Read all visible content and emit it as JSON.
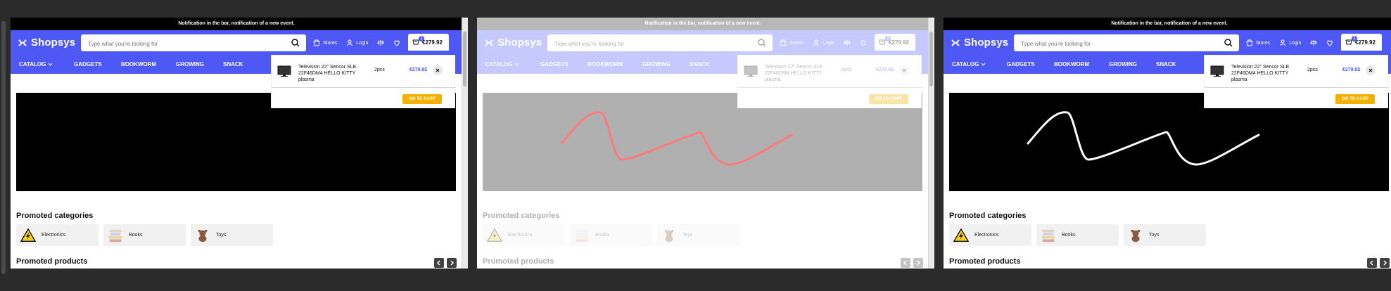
{
  "notification": "Notification in the bar, notification of a new event.",
  "brand": "Shopsys",
  "search": {
    "placeholder": "Type what you're looking for"
  },
  "header_links": [
    {
      "label": "Stores",
      "icon": "store-icon"
    },
    {
      "label": "Login",
      "icon": "user-icon"
    },
    {
      "label": "",
      "icon": "scale-icon"
    },
    {
      "label": "",
      "icon": "heart-icon"
    }
  ],
  "cart": {
    "count": "1",
    "total": "€279.92",
    "item": {
      "name": "Television 22\" Sencor SLE 22F46DM4 HELLO KITTY plasma",
      "quantity": "2pcs",
      "price": "€279.92"
    },
    "go_to_cart": "GO TO CART"
  },
  "nav": [
    "CATALOG",
    "GADGETS",
    "BOOKWORM",
    "GROWING",
    "SNACK"
  ],
  "promoted_categories_title": "Promoted categories",
  "categories": [
    {
      "name": "Electronics",
      "icon": "warning-icon"
    },
    {
      "name": "Books",
      "icon": "books-icon"
    },
    {
      "name": "Toys",
      "icon": "teddy-bear-icon"
    }
  ],
  "promoted_products_title": "Promoted products",
  "colors": {
    "brand": "#4e58f5",
    "accent": "#f2b100",
    "red_stroke": "#ff1a1a"
  }
}
